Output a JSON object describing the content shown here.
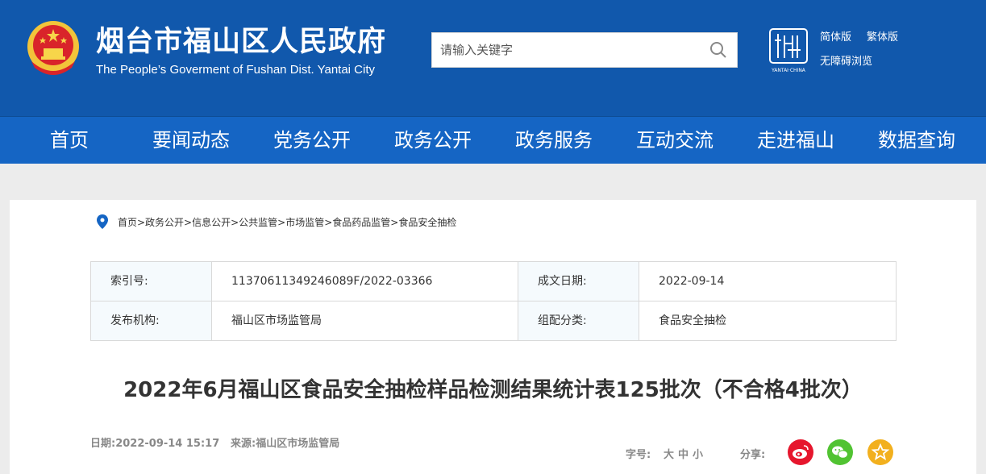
{
  "header": {
    "title": "烟台市福山区人民政府",
    "subtitle": "The People’s Goverment of Fushan Dist. Yantai City",
    "search_placeholder": "请输入关键字",
    "lang_simplified": "简体版",
    "lang_traditional": "繁体版",
    "accessible": "无障碍浏览",
    "colors": {
      "header_bg": "#1158ac",
      "nav_bg": "#1565c4"
    }
  },
  "nav": {
    "items": [
      "首页",
      "要闻动态",
      "党务公开",
      "政务公开",
      "政务服务",
      "互动交流",
      "走进福山",
      "数据查询"
    ]
  },
  "breadcrumb": "首页>政务公开>信息公开>公共监管>市场监管>食品药品监管>食品安全抽检",
  "meta": {
    "index_label": "索引号:",
    "index_value": "11370611349246089F/2022-03366",
    "date_label": "成文日期:",
    "date_value": "2022-09-14",
    "publisher_label": "发布机构:",
    "publisher_value": "福山区市场监管局",
    "category_label": "组配分类:",
    "category_value": "食品安全抽检"
  },
  "article": {
    "title": "2022年6月福山区食品安全抽检样品检测结果统计表125批次（不合格4批次）",
    "date": "日期:2022-09-14 15:17",
    "source": "来源:福山区市场监管局",
    "font_label": "字号:",
    "font_large": "大",
    "font_medium": "中",
    "font_small": "小",
    "share_label": "分享:"
  }
}
